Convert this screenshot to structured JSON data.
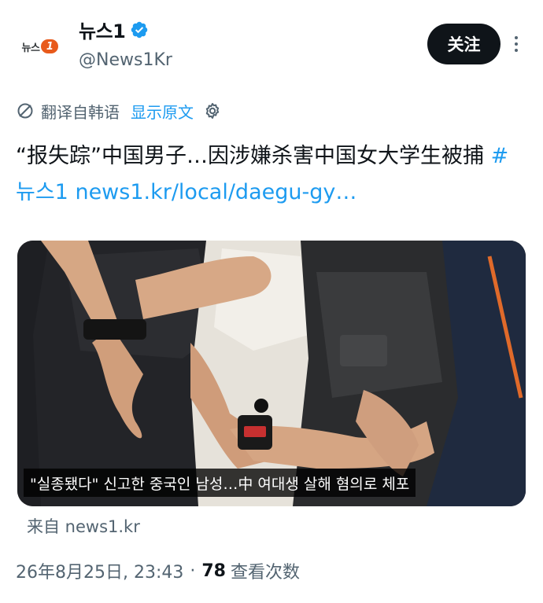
{
  "account": {
    "display_name": "뉴스1",
    "handle": "@News1Kr",
    "logo_text": "뉴스",
    "logo_number": "1"
  },
  "actions": {
    "follow_label": "关注"
  },
  "translation": {
    "translated_label": "翻译自韩语",
    "show_original_label": "显示原文"
  },
  "tweet": {
    "text_main": "“报失踪”中国男子…因涉嫌杀害中国女大学生被捕 ",
    "hashtag": "#뉴스1",
    "link_text": "news1.kr/local/daegu-gy…"
  },
  "media": {
    "caption": "\"실종됐다\" 신고한 중국인 남성…中 여대생 살해 혐의로 체포"
  },
  "source_label": "来自 news1.kr",
  "meta": {
    "timestamp": "26年8月25日, 23:43",
    "separator": "·",
    "views_count": "78",
    "views_label": "查看次数"
  },
  "colors": {
    "accent": "#1d9bf0",
    "text_primary": "#0f1419",
    "text_secondary": "#536471",
    "brand_orange": "#e85a1b"
  }
}
